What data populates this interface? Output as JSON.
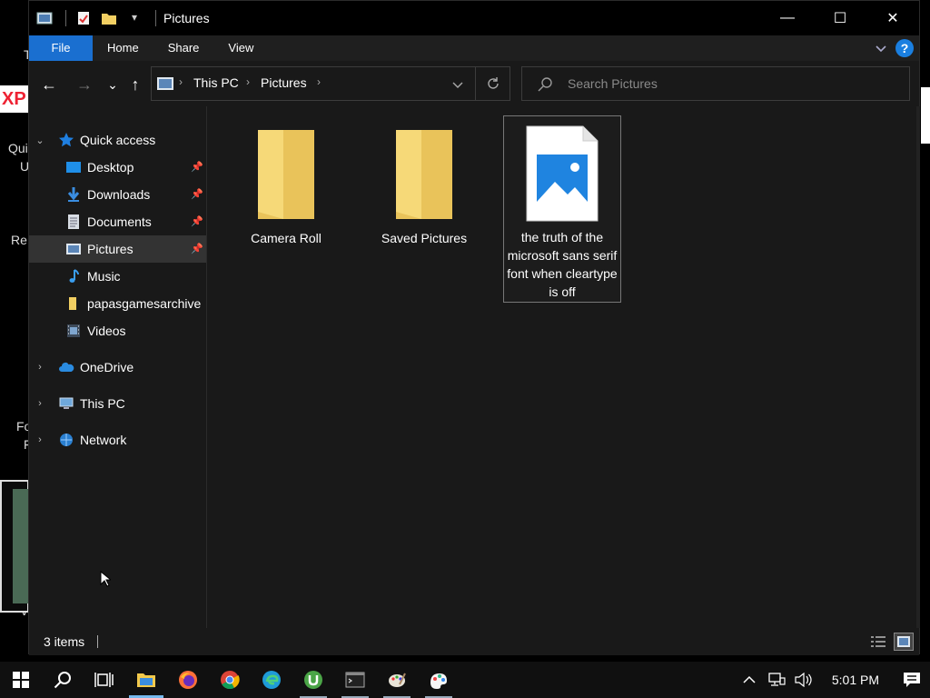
{
  "window": {
    "title": "Pictures",
    "controls": {
      "minimize": "—",
      "maximize": "☐",
      "close": "✕"
    }
  },
  "ribbon": {
    "tabs": [
      "File",
      "Home",
      "Share",
      "View"
    ],
    "help": "?"
  },
  "navigation": {
    "back": "←",
    "forward": "→",
    "recent": "⌄",
    "up": "↑",
    "breadcrumb": [
      "This PC",
      "Pictures"
    ],
    "search_placeholder": "Search Pictures"
  },
  "sidebar": {
    "items": [
      {
        "label": "Quick access",
        "icon": "star-icon",
        "expander": "⌄",
        "pinned": false
      },
      {
        "label": "Desktop",
        "icon": "desktop-icon",
        "pinned": true
      },
      {
        "label": "Downloads",
        "icon": "download-icon",
        "pinned": true
      },
      {
        "label": "Documents",
        "icon": "document-icon",
        "pinned": true
      },
      {
        "label": "Pictures",
        "icon": "pictures-icon",
        "pinned": true,
        "selected": true
      },
      {
        "label": "Music",
        "icon": "music-icon",
        "pinned": false
      },
      {
        "label": "papasgamesarchive",
        "icon": "folder-icon",
        "pinned": false
      },
      {
        "label": "Videos",
        "icon": "video-icon",
        "pinned": false
      },
      {
        "label": "OneDrive",
        "icon": "cloud-icon",
        "expander": "›"
      },
      {
        "label": "This PC",
        "icon": "computer-icon",
        "expander": "›"
      },
      {
        "label": "Network",
        "icon": "network-icon",
        "expander": "›"
      }
    ]
  },
  "files": [
    {
      "name": "Camera Roll",
      "type": "folder"
    },
    {
      "name": "Saved Pictures",
      "type": "folder"
    },
    {
      "name": "the truth of the microsoft sans serif font when cleartype is off",
      "type": "image",
      "selected": true
    }
  ],
  "status": {
    "count": "3 items"
  },
  "taskbar": {
    "apps": [
      "windows-start-icon",
      "search-icon",
      "task-view-icon",
      "file-explorer-icon",
      "firefox-icon",
      "chrome-icon",
      "edge-icon",
      "utorrent-icon",
      "terminal-icon",
      "paint-icon",
      "paint-3d-icon"
    ],
    "clock": "5:01 PM"
  },
  "desktop_fragments": [
    "Qui",
    "U",
    "Re",
    "Fo",
    "F",
    "V",
    "T",
    "XP"
  ],
  "colors": {
    "accent": "#1a6fd0",
    "folder": "#f2cf62",
    "background": "#191919"
  }
}
